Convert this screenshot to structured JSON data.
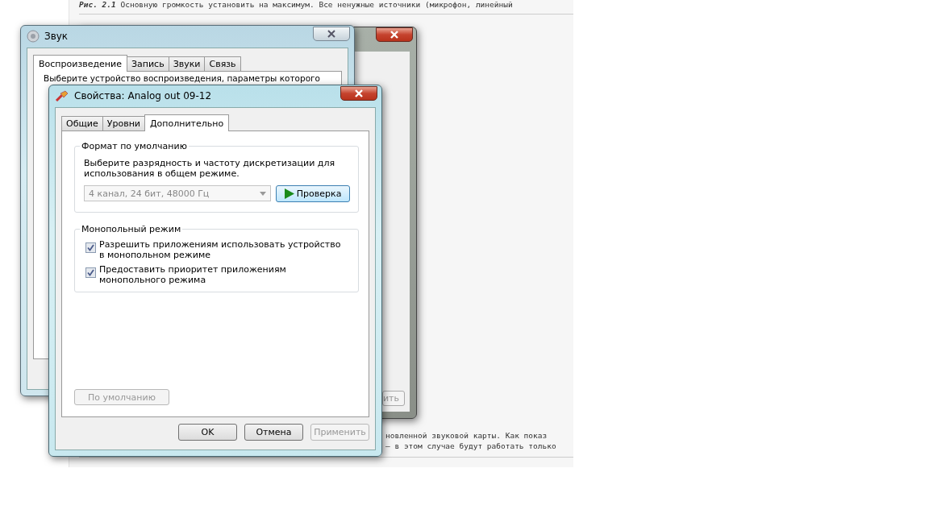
{
  "page": {
    "caption": "**Рис. 2.1** Основную громкость установить на максимум. Все ненужные источники (микрофон, линейный",
    "lines": [
      "новленной звуковой карты. Как показ",
      "— в этом случае будут работать только"
    ]
  },
  "back_window": {
    "button_fragment": "ить"
  },
  "sound_window": {
    "title": "Звук",
    "tabs": [
      {
        "label": "Воспроизведение",
        "selected": true
      },
      {
        "label": "Запись",
        "selected": false
      },
      {
        "label": "Звуки",
        "selected": false
      },
      {
        "label": "Связь",
        "selected": false
      }
    ],
    "description": "Выберите устройство воспроизведения, параметры которого"
  },
  "properties_window": {
    "title": "Свойства: Analog out 09-12",
    "tabs": [
      {
        "label": "Общие",
        "selected": false
      },
      {
        "label": "Уровни",
        "selected": false
      },
      {
        "label": "Дополнительно",
        "selected": true
      }
    ],
    "default_format": {
      "title": "Формат по умолчанию",
      "description": "Выберите разрядность и частоту дискретизации для использования в общем режиме.",
      "format": {
        "value": "4 канал, 24 бит, 48000 Гц",
        "disabled": true
      },
      "test_button": "Проверка"
    },
    "exclusive_mode": {
      "title": "Монопольный режим",
      "options": [
        {
          "label": "Разрешить приложениям использовать устройство в монопольном режиме",
          "checked": true
        },
        {
          "label": "Предоставить приоритет приложениям монопольного режима",
          "checked": true
        }
      ]
    },
    "restore_button": {
      "label": "По умолчанию",
      "disabled": true
    },
    "buttons": [
      {
        "label": "OK",
        "disabled": false
      },
      {
        "label": "Отмена",
        "disabled": false
      },
      {
        "label": "Применить",
        "disabled": true
      }
    ]
  }
}
